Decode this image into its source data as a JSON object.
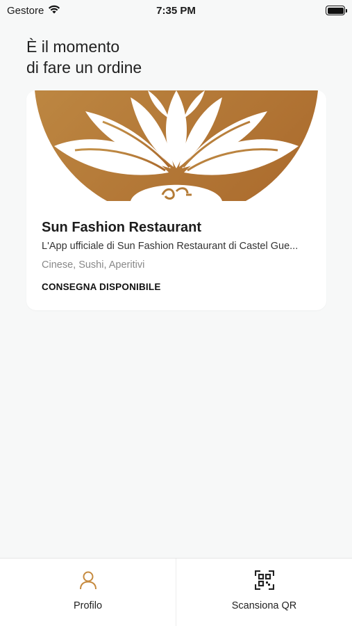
{
  "status_bar": {
    "carrier": "Gestore",
    "time": "7:35 PM",
    "wifi_icon": "wifi-icon",
    "battery_icon": "battery-icon",
    "battery_level": 1.0
  },
  "heading": {
    "line1": "È il momento",
    "line2": "di fare un ordine"
  },
  "restaurant_card": {
    "image_icon": "lotus-logo",
    "name": "Sun Fashion Restaurant",
    "description": "L'App ufficiale di Sun Fashion Restaurant di Castel Gue...",
    "tags": "Cinese, Sushi, Aperitivi",
    "delivery_status": "CONSEGNA DISPONIBILE",
    "colors": {
      "logo_gold": "#b9803a",
      "logo_dark": "#a6652a"
    }
  },
  "tab_bar": {
    "tabs": [
      {
        "label": "Profilo",
        "icon": "person-icon",
        "icon_color": "#c68a3e"
      },
      {
        "label": "Scansiona QR",
        "icon": "qr-scan-icon",
        "icon_color": "#222222"
      }
    ]
  }
}
